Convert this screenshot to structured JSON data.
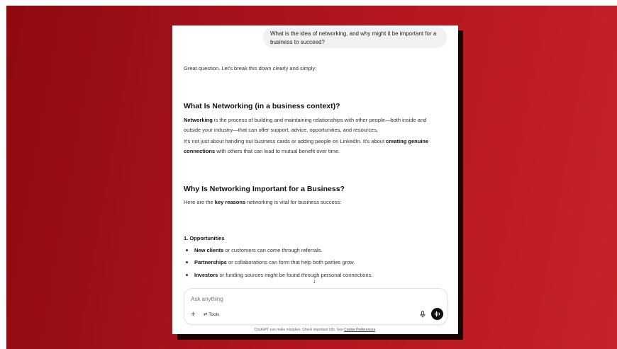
{
  "user_message": "What is the idea of networking, and why might it be important for a business to succeed?",
  "assistant": {
    "intro": "Great question. Let's break this down clearly and simply:",
    "section1": {
      "heading": "What Is Networking (in a business context)?",
      "p1_bold": "Networking",
      "p1_rest": " is the process of building and maintaining relationships with other people—both inside and outside your industry—that can offer support, advice, opportunities, and resources.",
      "p2_start": "It's not just about handing out business cards or adding people on LinkedIn. It's about ",
      "p2_bold": "creating genuine connections",
      "p2_end": " with others that can lead to mutual benefit over time."
    },
    "section2": {
      "heading": "Why Is Networking Important for a Business?",
      "p_start": "Here are the ",
      "p_bold": "key reasons",
      "p_end": " networking is vital for business success:"
    },
    "section3": {
      "heading": "1. Opportunities",
      "items": [
        {
          "bold": "New clients",
          "rest": " or customers can come through referrals."
        },
        {
          "bold": "Partnerships",
          "rest": " or collaborations can form that help both parties grow."
        },
        {
          "bold": "Investors",
          "rest": " or funding sources might be found through personal connections."
        }
      ]
    }
  },
  "composer": {
    "placeholder": "Ask anything",
    "plus_glyph": "+",
    "tools_glyph": "⇄",
    "tools_label": "Tools"
  },
  "scroll_glyph": "↓",
  "footer": {
    "text": "ChatGPT can make mistakes. Check important info. See ",
    "link": "Cookie Preferences",
    "end": "."
  },
  "icons": [
    "plus-icon",
    "tools-icon",
    "microphone-icon",
    "voice-mode-icon",
    "scroll-down-icon"
  ],
  "colors": {
    "background_red": "#b5171f",
    "voice_button": "#0d0d0d",
    "bubble": "#f2f2f2"
  }
}
